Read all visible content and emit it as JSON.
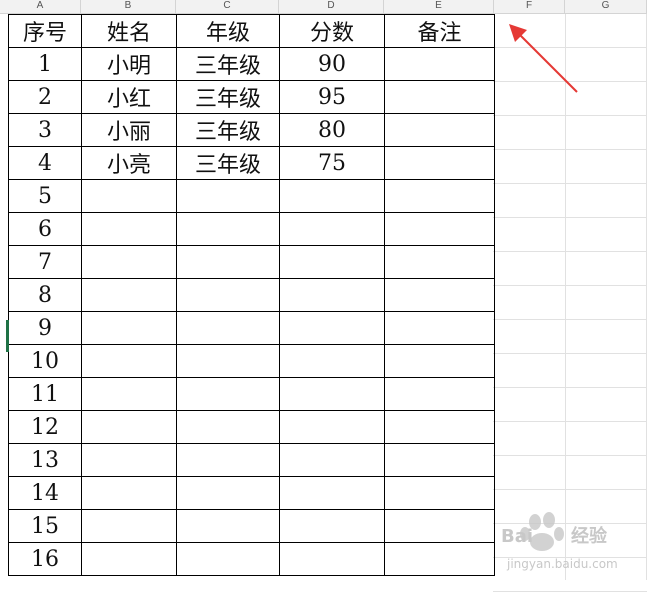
{
  "column_headers": [
    "A",
    "B",
    "C",
    "D",
    "E",
    "F",
    "G"
  ],
  "table": {
    "headers": [
      "序号",
      "姓名",
      "年级",
      "分数",
      "备注"
    ],
    "rows": [
      [
        "1",
        "小明",
        "三年级",
        "90",
        ""
      ],
      [
        "2",
        "小红",
        "三年级",
        "95",
        ""
      ],
      [
        "3",
        "小丽",
        "三年级",
        "80",
        ""
      ],
      [
        "4",
        "小亮",
        "三年级",
        "75",
        ""
      ],
      [
        "5",
        "",
        "",
        "",
        ""
      ],
      [
        "6",
        "",
        "",
        "",
        ""
      ],
      [
        "7",
        "",
        "",
        "",
        ""
      ],
      [
        "8",
        "",
        "",
        "",
        ""
      ],
      [
        "9",
        "",
        "",
        "",
        ""
      ],
      [
        "10",
        "",
        "",
        "",
        ""
      ],
      [
        "11",
        "",
        "",
        "",
        ""
      ],
      [
        "12",
        "",
        "",
        "",
        ""
      ],
      [
        "13",
        "",
        "",
        "",
        ""
      ],
      [
        "14",
        "",
        "",
        "",
        ""
      ],
      [
        "15",
        "",
        "",
        "",
        ""
      ],
      [
        "16",
        "",
        "",
        "",
        ""
      ]
    ]
  },
  "annotation": {
    "color": "#e53935"
  },
  "watermark": {
    "text": "jingyan.baidu.com",
    "logo_name": "baidu-jingyan-logo"
  }
}
